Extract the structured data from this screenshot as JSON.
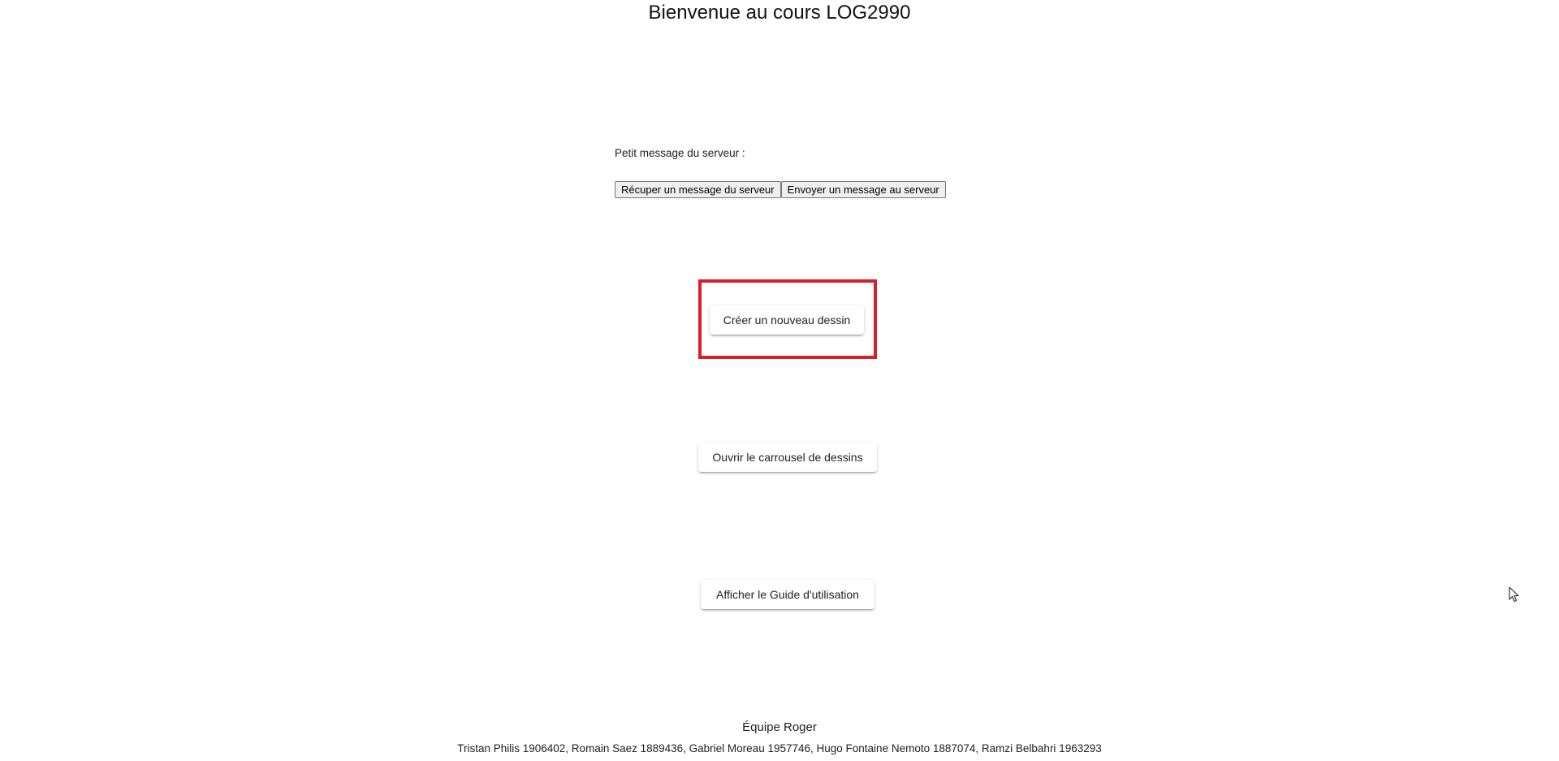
{
  "page": {
    "title": "Bienvenue au cours LOG2990"
  },
  "server": {
    "label": "Petit message du serveur :",
    "fetch_button": "Récuper un message du serveur",
    "send_button": "Envoyer un message au serveur"
  },
  "actions": {
    "new_drawing": "Créer un nouveau dessin",
    "open_carousel": "Ouvrir le carrousel de dessins",
    "show_guide": "Afficher le Guide d'utilisation"
  },
  "footer": {
    "team": "Équipe Roger",
    "members": "Tristan Philis 1906402, Romain Saez 1889436, Gabriel Moreau 1957746, Hugo Fontaine Nemoto 1887074, Ramzi Belbahri 1963293"
  },
  "colors": {
    "highlight": "#d81e27"
  },
  "icons": {
    "cursor": "mouse-pointer-icon"
  }
}
